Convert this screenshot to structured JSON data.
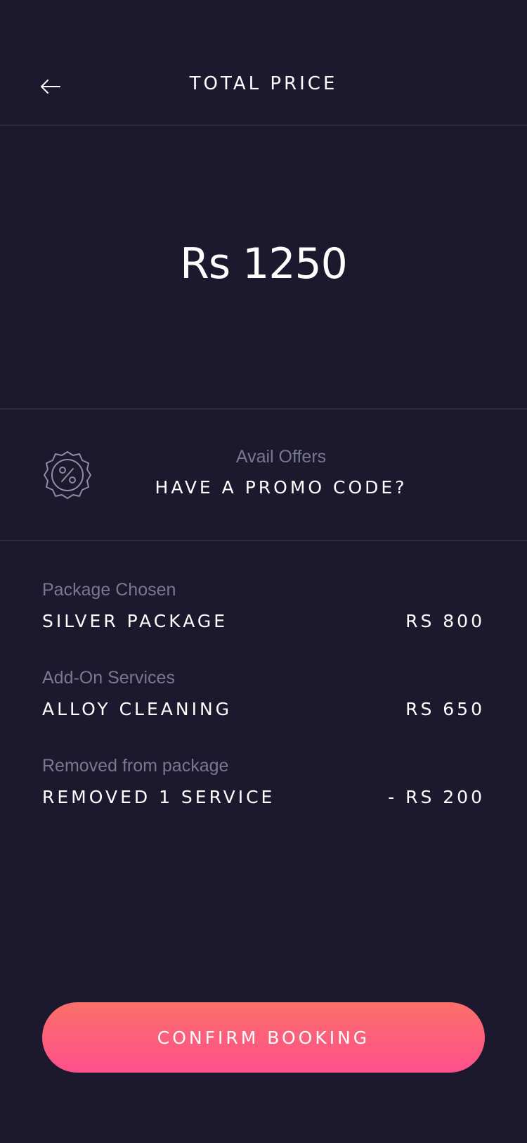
{
  "colors": {
    "background": "#1c182e",
    "divider": "#2d2a40",
    "text_primary": "#ffffff",
    "text_secondary": "#7a7891",
    "button_gradient_start": "#fb7069",
    "button_gradient_end": "#ff4f8c"
  },
  "header": {
    "back_icon": "arrow-left-icon",
    "title": "TOTAL PRICE"
  },
  "total": {
    "amount": "Rs 1250"
  },
  "promo": {
    "icon": "discount-badge-icon",
    "subtitle": "Avail Offers",
    "title": "HAVE A PROMO CODE?"
  },
  "items": [
    {
      "label": "Package Chosen",
      "name": "SILVER PACKAGE",
      "price": "RS 800"
    },
    {
      "label": "Add-On Services",
      "name": "ALLOY CLEANING",
      "price": "RS 650"
    },
    {
      "label": "Removed from package",
      "name": "REMOVED 1 SERVICE",
      "price": "- RS 200"
    }
  ],
  "actions": {
    "confirm_label": "CONFIRM BOOKING"
  }
}
